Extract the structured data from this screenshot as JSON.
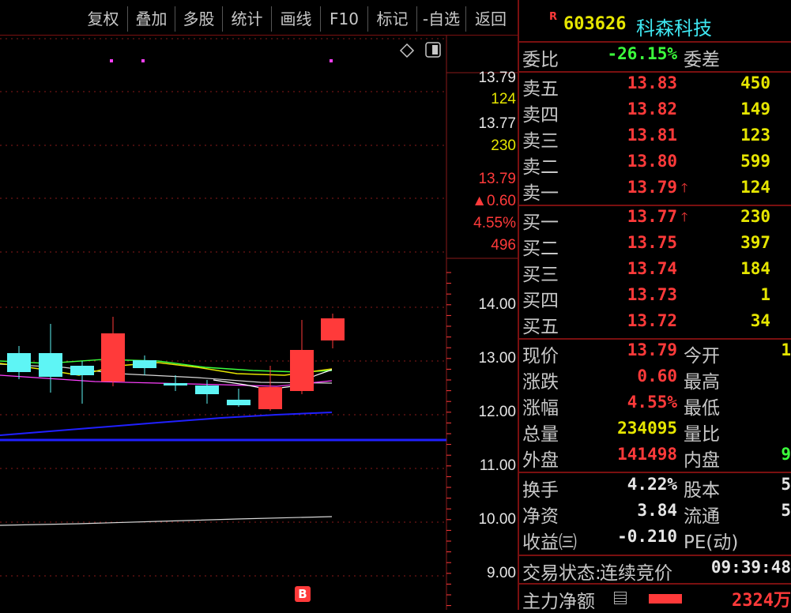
{
  "toolbar": {
    "buttons": [
      "复权",
      "叠加",
      "多股",
      "统计",
      "画线",
      "F10",
      "标记",
      "-自选",
      "返回"
    ]
  },
  "chart": {
    "price_axis": [
      "14.00",
      "13.00",
      "12.00",
      "11.00",
      "10.00",
      "9.00"
    ],
    "side_quote": {
      "ask_price": "13.79",
      "ask_vol": "124",
      "bid_price": "13.77",
      "bid_vol": "230",
      "last": "13.79",
      "change": "▲0.60",
      "change_pct": "4.55%",
      "vol": "496"
    },
    "b_marker": "B",
    "colors": {
      "up": "#ff3a3a",
      "down": "#5ef5f5",
      "ma_white": "#d8d8d8",
      "ma_yellow": "#e6e600",
      "ma_magenta": "#ff40ff",
      "ma_green": "#3cff3c",
      "ma_blue": "#2020ff",
      "grid": "#8a1a1a"
    }
  },
  "quote": {
    "flag": "R",
    "code": "603626",
    "name": "科森科技",
    "wei_bi_label": "委比",
    "wei_bi_value": "-26.15%",
    "wei_cha_label": "委差",
    "asks": [
      {
        "label": "卖五",
        "price": "13.83",
        "vol": "450"
      },
      {
        "label": "卖四",
        "price": "13.82",
        "vol": "149"
      },
      {
        "label": "卖三",
        "price": "13.81",
        "vol": "123"
      },
      {
        "label": "卖二",
        "price": "13.80",
        "vol": "599"
      },
      {
        "label": "卖一",
        "price": "13.79",
        "vol": "124"
      }
    ],
    "bids": [
      {
        "label": "买一",
        "price": "13.77",
        "vol": "230"
      },
      {
        "label": "买二",
        "price": "13.75",
        "vol": "397"
      },
      {
        "label": "买三",
        "price": "13.74",
        "vol": "184"
      },
      {
        "label": "买四",
        "price": "13.73",
        "vol": "1"
      },
      {
        "label": "买五",
        "price": "13.72",
        "vol": "34"
      }
    ],
    "stats": [
      {
        "l1": "现价",
        "v1": "13.79",
        "l2": "今开",
        "v2": "1"
      },
      {
        "l1": "涨跌",
        "v1": "0.60",
        "l2": "最高",
        "v2": ""
      },
      {
        "l1": "涨幅",
        "v1": "4.55%",
        "l2": "最低",
        "v2": ""
      },
      {
        "l1": "总量",
        "v1": "234095",
        "l2": "量比",
        "v2": ""
      },
      {
        "l1": "外盘",
        "v1": "141498",
        "l2": "内盘",
        "v2": "9"
      }
    ],
    "stats2": [
      {
        "l1": "换手",
        "v1": "4.22%",
        "l2": "股本",
        "v2": "5"
      },
      {
        "l1": "净资",
        "v1": "3.84",
        "l2": "流通",
        "v2": "5"
      },
      {
        "l1": "收益㈢",
        "v1": "-0.210",
        "l2": "PE(动)",
        "v2": ""
      }
    ],
    "trade_status_label": "交易状态:",
    "trade_status_value": "连续竞价",
    "trade_time": "09:39:48",
    "main_flow_label": "主力净额",
    "main_flow_value": "2324万"
  }
}
